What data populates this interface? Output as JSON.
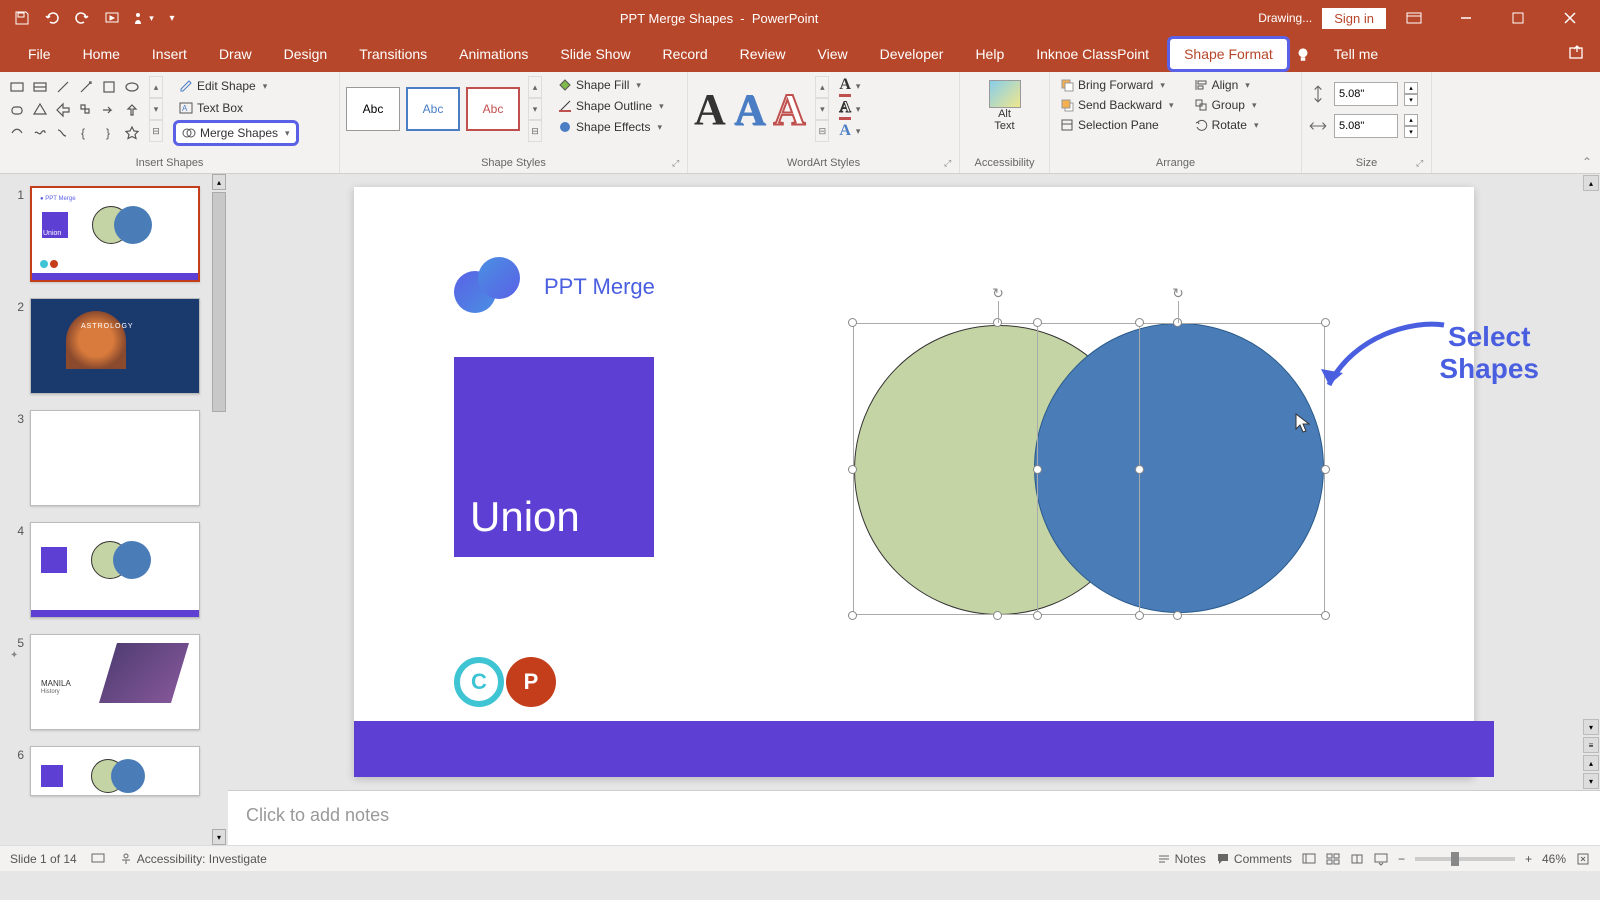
{
  "title": {
    "doc": "PPT Merge Shapes",
    "app": "PowerPoint"
  },
  "titlebar": {
    "drawing": "Drawing...",
    "signin": "Sign in"
  },
  "tabs": [
    "File",
    "Home",
    "Insert",
    "Draw",
    "Design",
    "Transitions",
    "Animations",
    "Slide Show",
    "Record",
    "Review",
    "View",
    "Developer",
    "Help",
    "Inknoe ClassPoint"
  ],
  "shape_format_tab": "Shape Format",
  "tell_me": "Tell me",
  "insert_shapes": {
    "edit_shape": "Edit Shape",
    "text_box": "Text Box",
    "merge_shapes": "Merge Shapes",
    "group_label": "Insert Shapes"
  },
  "shape_styles": {
    "abc": "Abc",
    "fill": "Shape Fill",
    "outline": "Shape Outline",
    "effects": "Shape Effects",
    "group_label": "Shape Styles"
  },
  "wordart": {
    "group_label": "WordArt Styles"
  },
  "accessibility": {
    "group_label": "Accessibility"
  },
  "alt_text": {
    "line1": "Alt",
    "line2": "Text"
  },
  "arrange": {
    "bring_forward": "Bring Forward",
    "send_backward": "Send Backward",
    "selection_pane": "Selection Pane",
    "align": "Align",
    "group": "Group",
    "rotate": "Rotate",
    "group_label": "Arrange"
  },
  "size": {
    "height": "5.08\"",
    "width": "5.08\"",
    "group_label": "Size"
  },
  "slide": {
    "logo_text": "PPT Merge",
    "union": "Union",
    "annotation_l1": "Select",
    "annotation_l2": "Shapes"
  },
  "notes_placeholder": "Click to add notes",
  "status": {
    "slide": "Slide 1 of 14",
    "accessibility": "Accessibility: Investigate",
    "notes": "Notes",
    "comments": "Comments",
    "zoom": "46%"
  },
  "thumbs": [
    "1",
    "2",
    "3",
    "4",
    "5",
    "6"
  ]
}
